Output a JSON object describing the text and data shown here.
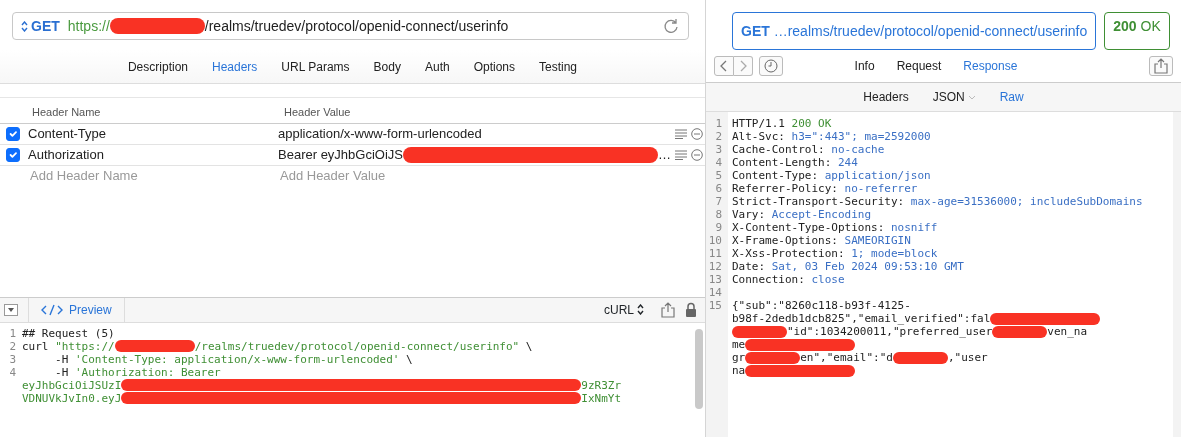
{
  "request_bar": {
    "method": "GET",
    "url": [
      {
        "kind": "scheme",
        "text": "https://"
      },
      {
        "kind": "redaction"
      },
      {
        "kind": "path",
        "text": "/realms/truedev/protocol/openid-connect/userinfo"
      }
    ]
  },
  "tabs": [
    {
      "label": "Description",
      "selected": false
    },
    {
      "label": "Headers",
      "selected": true
    },
    {
      "label": "URL Params",
      "selected": false
    },
    {
      "label": "Body",
      "selected": false
    },
    {
      "label": "Auth",
      "selected": false
    },
    {
      "label": "Options",
      "selected": false
    },
    {
      "label": "Testing",
      "selected": false
    }
  ],
  "headers_table": {
    "columns": [
      "Header Name",
      "Header Value"
    ],
    "rows": [
      {
        "enabled": true,
        "name": "Content-Type",
        "value": [
          {
            "kind": "text",
            "text": "application/x-www-form-urlencoded"
          }
        ]
      },
      {
        "enabled": true,
        "name": "Authorization",
        "value": [
          {
            "kind": "text",
            "text": "Bearer eyJhbGciOiJS"
          },
          {
            "kind": "redaction"
          },
          {
            "kind": "text",
            "text": "…"
          }
        ]
      }
    ],
    "new_row": {
      "name_placeholder": "Add Header Name",
      "value_placeholder": "Add Header Value"
    }
  },
  "preview": {
    "tab": "Preview",
    "format": "cURL",
    "lines": [
      {
        "number": "1",
        "parts": [
          {
            "kind": "plain",
            "text": "## Request (5)"
          }
        ]
      },
      {
        "number": "2",
        "parts": [
          {
            "kind": "plain",
            "text": "curl "
          },
          {
            "kind": "string",
            "text": "\"https://"
          },
          {
            "kind": "redaction"
          },
          {
            "kind": "string",
            "text": "/realms/truedev/protocol/openid-connect/userinfo\""
          },
          {
            "kind": "plain",
            "text": " \\"
          }
        ]
      },
      {
        "number": "3",
        "parts": [
          {
            "kind": "plain",
            "text": "     -H "
          },
          {
            "kind": "string",
            "text": "'Content-Type: application/x-www-form-urlencoded'"
          },
          {
            "kind": "plain",
            "text": " \\"
          }
        ]
      },
      {
        "number": "4",
        "parts": [
          {
            "kind": "plain",
            "text": "     -H "
          },
          {
            "kind": "string",
            "text": "'Authorization: Bearer"
          }
        ]
      },
      {
        "parts": [
          {
            "kind": "string",
            "text": "eyJhbGciOiJSUzI"
          },
          {
            "kind": "redaction"
          },
          {
            "kind": "string",
            "text": "9zR3Zr"
          }
        ]
      },
      {
        "parts": [
          {
            "kind": "string",
            "text": "VDNUVkJvIn0.eyJ"
          },
          {
            "kind": "redaction"
          },
          {
            "kind": "string",
            "text": "IxNmYt"
          }
        ]
      }
    ]
  },
  "response_bar": {
    "method": "GET",
    "url": "…realms/truedev/protocol/openid-connect/userinfo",
    "status_code": "200",
    "status_text": "OK"
  },
  "response_tabs": [
    {
      "label": "Info",
      "selected": false
    },
    {
      "label": "Request",
      "selected": false
    },
    {
      "label": "Response",
      "selected": true
    }
  ],
  "response_views": [
    {
      "label": "Headers",
      "selected": false,
      "dropdown": false
    },
    {
      "label": "JSON",
      "selected": false,
      "dropdown": true
    },
    {
      "label": "Raw",
      "selected": true,
      "dropdown": false
    }
  ],
  "response_lines": [
    {
      "number": "1",
      "parts": [
        {
          "kind": "plain",
          "text": "HTTP/1.1 "
        },
        {
          "kind": "status",
          "text": "200 OK"
        }
      ]
    },
    {
      "number": "2",
      "parts": [
        {
          "kind": "plain",
          "text": "Alt-Svc: "
        },
        {
          "kind": "value",
          "text": "h3=\":443\"; ma=2592000"
        }
      ]
    },
    {
      "number": "3",
      "parts": [
        {
          "kind": "plain",
          "text": "Cache-Control: "
        },
        {
          "kind": "value",
          "text": "no-cache"
        }
      ]
    },
    {
      "number": "4",
      "parts": [
        {
          "kind": "plain",
          "text": "Content-Length: "
        },
        {
          "kind": "value",
          "text": "244"
        }
      ]
    },
    {
      "number": "5",
      "parts": [
        {
          "kind": "plain",
          "text": "Content-Type: "
        },
        {
          "kind": "value",
          "text": "application/json"
        }
      ]
    },
    {
      "number": "6",
      "parts": [
        {
          "kind": "plain",
          "text": "Referrer-Policy: "
        },
        {
          "kind": "value",
          "text": "no-referrer"
        }
      ]
    },
    {
      "number": "7",
      "parts": [
        {
          "kind": "plain",
          "text": "Strict-Transport-Security: "
        },
        {
          "kind": "value",
          "text": "max-age=31536000; includeSubDomains"
        }
      ]
    },
    {
      "number": "8",
      "parts": [
        {
          "kind": "plain",
          "text": "Vary: "
        },
        {
          "kind": "value",
          "text": "Accept-Encoding"
        }
      ]
    },
    {
      "number": "9",
      "parts": [
        {
          "kind": "plain",
          "text": "X-Content-Type-Options: "
        },
        {
          "kind": "value",
          "text": "nosniff"
        }
      ]
    },
    {
      "number": "10",
      "parts": [
        {
          "kind": "plain",
          "text": "X-Frame-Options: "
        },
        {
          "kind": "value",
          "text": "SAMEORIGIN"
        }
      ]
    },
    {
      "number": "11",
      "parts": [
        {
          "kind": "plain",
          "text": "X-Xss-Protection: "
        },
        {
          "kind": "value",
          "text": "1; mode=block"
        }
      ]
    },
    {
      "number": "12",
      "parts": [
        {
          "kind": "plain",
          "text": "Date: "
        },
        {
          "kind": "value",
          "text": "Sat, 03 Feb 2024 09:53:10 GMT"
        }
      ]
    },
    {
      "number": "13",
      "parts": [
        {
          "kind": "plain",
          "text": "Connection: "
        },
        {
          "kind": "value",
          "text": "close"
        }
      ]
    },
    {
      "number": "14"
    },
    {
      "number": "15",
      "parts": [
        {
          "kind": "plain",
          "text": "{\"sub\":\"8260c118-b93f-4125-"
        }
      ]
    },
    {
      "parts": [
        {
          "kind": "plain",
          "text": "b98f-2dedb1dcb825\",\"email_verified\":fal"
        },
        {
          "kind": "redaction"
        }
      ]
    },
    {
      "parts": [
        {
          "kind": "redaction"
        },
        {
          "kind": "plain",
          "text": "\"id\":1034200011,\"preferred_user"
        },
        {
          "kind": "redaction"
        },
        {
          "kind": "plain",
          "text": "ven_na"
        }
      ]
    },
    {
      "parts": [
        {
          "kind": "plain",
          "text": "me"
        },
        {
          "kind": "redaction"
        }
      ]
    },
    {
      "parts": [
        {
          "kind": "plain",
          "text": "gr"
        },
        {
          "kind": "redaction"
        },
        {
          "kind": "plain",
          "text": "en\",\"email\":\"d"
        },
        {
          "kind": "redaction"
        },
        {
          "kind": "plain",
          "text": ",\"user"
        }
      ]
    },
    {
      "parts": [
        {
          "kind": "plain",
          "text": "na"
        },
        {
          "kind": "redaction"
        }
      ]
    }
  ]
}
